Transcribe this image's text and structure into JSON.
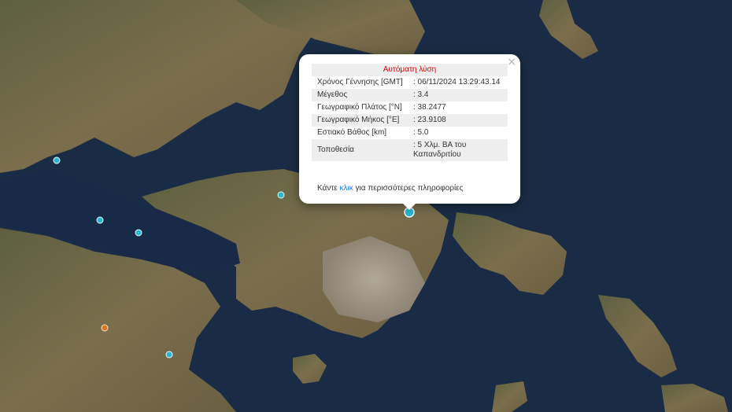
{
  "popup": {
    "title": "Αυτόματη λύση",
    "close_symbol": "×",
    "rows": [
      {
        "label": "Χρόνος Γέννησης [GMT]",
        "value": ": 06/11/2024 13:29:43.14"
      },
      {
        "label": "Μέγεθος",
        "value": ": 3.4"
      },
      {
        "label": "Γεωγραφικό Πλάτος [°N]",
        "value": ": 38.2477"
      },
      {
        "label": "Γεωγραφικό Μήκος [°E]",
        "value": ": 23.9108"
      },
      {
        "label": "Εστιακό Βάθος [km]",
        "value": ": 5.0"
      },
      {
        "label": "Τοποθεσία",
        "value": ": 5 Χλμ. ΒΑ του Καπανδριτίου"
      }
    ],
    "more_prefix": "Κάντε",
    "more_link": "κλικ",
    "more_suffix": "για περισσότερες πληροφορίες"
  },
  "markers": [
    {
      "color": "#29b6d1",
      "label": "selected-event"
    },
    {
      "color": "#29b6d1",
      "label": "event"
    },
    {
      "color": "#29b6d1",
      "label": "event"
    },
    {
      "color": "#29b6d1",
      "label": "event"
    },
    {
      "color": "#29b6d1",
      "label": "event"
    },
    {
      "color": "#29b6d1",
      "label": "event"
    },
    {
      "color": "#e0731f",
      "label": "event"
    }
  ],
  "colors": {
    "sea": "#1a2c45",
    "land": "#6b6a45",
    "urban": "#9a8f80",
    "marker_recent": "#29b6d1",
    "marker_older": "#e0731f",
    "popup_title": "#e00000",
    "link": "#1a7ad9"
  }
}
